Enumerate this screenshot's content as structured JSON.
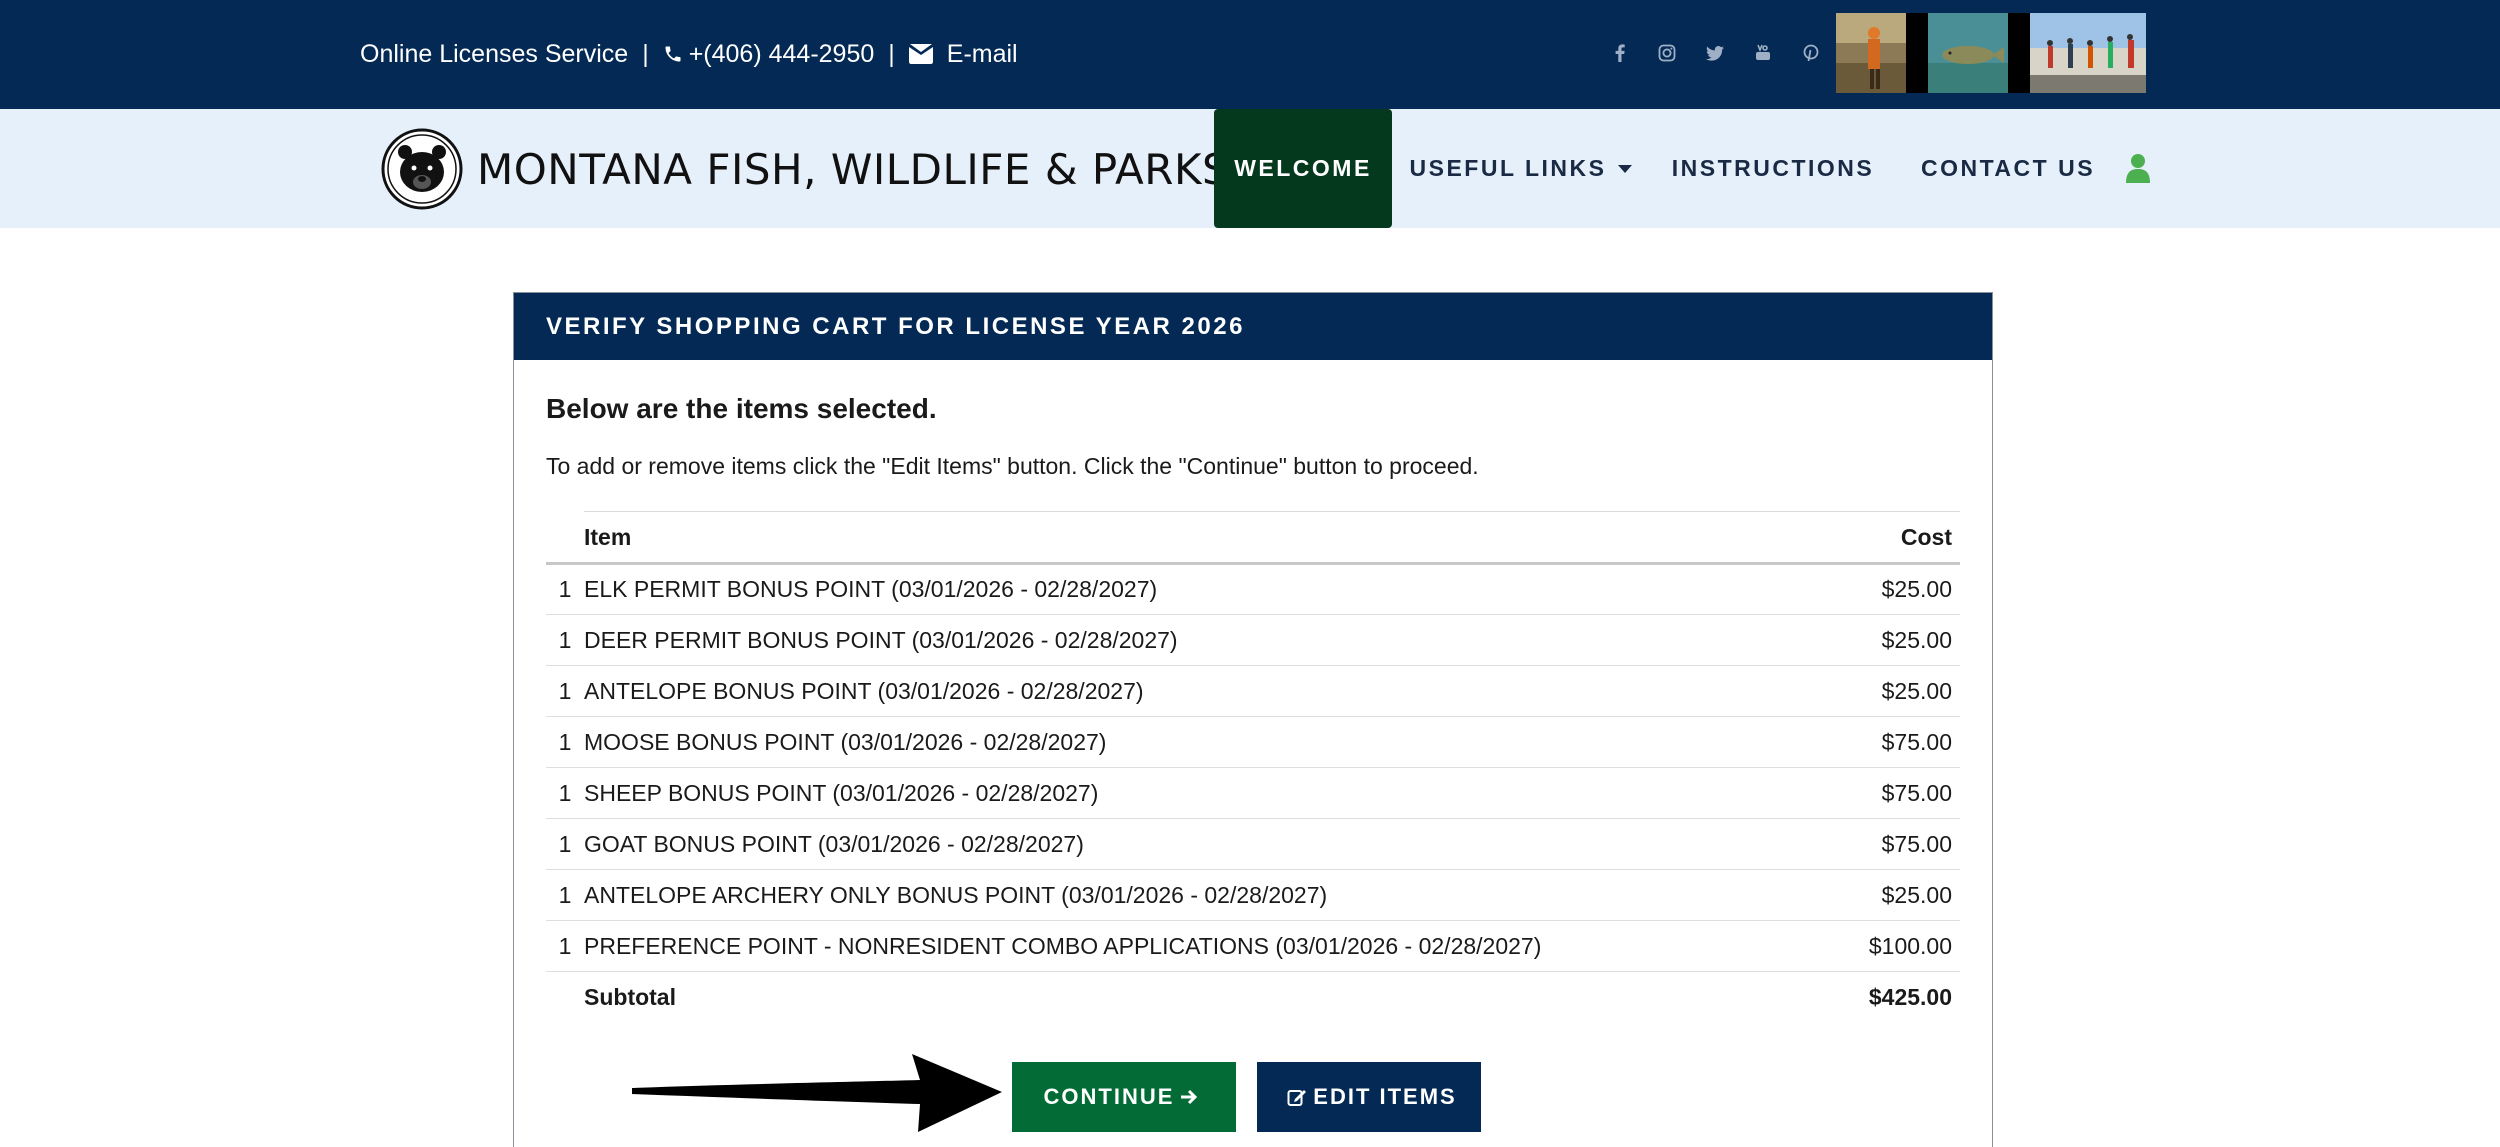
{
  "topbar": {
    "service_label": "Online Licenses Service",
    "separator": "|",
    "phone": "+(406) 444-2950",
    "email_label": "E-mail",
    "social_icons": [
      "facebook-icon",
      "instagram-icon",
      "twitter-icon",
      "youtube-icon",
      "pinterest-icon"
    ]
  },
  "nav": {
    "site_title": "MONTANA FISH, WILDLIFE & PARKS",
    "items": [
      {
        "label": "WELCOME",
        "active": true
      },
      {
        "label": "USEFUL LINKS",
        "dropdown": true
      },
      {
        "label": "INSTRUCTIONS"
      },
      {
        "label": "CONTACT US"
      }
    ]
  },
  "cart": {
    "title": "VERIFY SHOPPING CART FOR LICENSE YEAR 2026",
    "lead": "Below are the items selected.",
    "instructions": "To add or remove items click the \"Edit Items\" button.  Click the \"Continue\" button to proceed.",
    "columns": {
      "item": "Item",
      "cost": "Cost"
    },
    "rows": [
      {
        "qty": "1",
        "item": "ELK PERMIT BONUS POINT (03/01/2026 - 02/28/2027)",
        "cost": "$25.00"
      },
      {
        "qty": "1",
        "item": "DEER PERMIT BONUS POINT (03/01/2026 - 02/28/2027)",
        "cost": "$25.00"
      },
      {
        "qty": "1",
        "item": "ANTELOPE BONUS POINT (03/01/2026 - 02/28/2027)",
        "cost": "$25.00"
      },
      {
        "qty": "1",
        "item": "MOOSE BONUS POINT (03/01/2026 - 02/28/2027)",
        "cost": "$75.00"
      },
      {
        "qty": "1",
        "item": "SHEEP BONUS POINT (03/01/2026 - 02/28/2027)",
        "cost": "$75.00"
      },
      {
        "qty": "1",
        "item": "GOAT BONUS POINT (03/01/2026 - 02/28/2027)",
        "cost": "$75.00"
      },
      {
        "qty": "1",
        "item": "ANTELOPE ARCHERY ONLY BONUS POINT (03/01/2026 - 02/28/2027)",
        "cost": "$25.00"
      },
      {
        "qty": "1",
        "item": "PREFERENCE POINT - NONRESIDENT COMBO APPLICATIONS (03/01/2026 - 02/28/2027)",
        "cost": "$100.00"
      }
    ],
    "subtotal_label": "Subtotal",
    "subtotal_value": "$425.00"
  },
  "buttons": {
    "continue_label": "CONTINUE",
    "edit_label": "EDIT ITEMS"
  },
  "colors": {
    "navy": "#032954",
    "dark_green": "#04391e",
    "green": "#036b36",
    "nav_bg": "#e6f0fb",
    "user_icon": "#4caf50"
  }
}
